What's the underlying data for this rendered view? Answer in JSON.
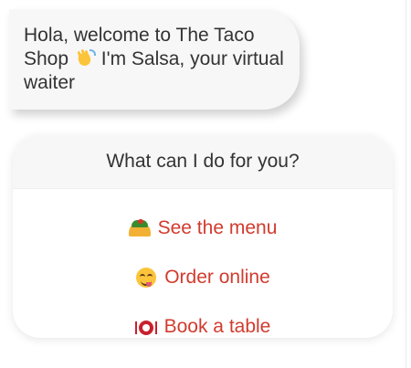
{
  "bot_message": {
    "text_before_emoji": "Hola, welcome to The Taco Shop",
    "emoji_icon": "waving-hand-icon",
    "text_after_emoji": "I'm Salsa, your virtual waiter"
  },
  "quick_replies": {
    "prompt": "What can I do for you?",
    "options": [
      {
        "icon": "taco-icon",
        "label": "See the menu"
      },
      {
        "icon": "face-savoring-food-icon",
        "label": "Order online"
      },
      {
        "icon": "plate-with-cutlery-icon",
        "label": "Book a table"
      }
    ]
  },
  "colors": {
    "accent_text": "#d23b2e",
    "bubble_bg": "#f7f7f7",
    "text": "#333333"
  }
}
